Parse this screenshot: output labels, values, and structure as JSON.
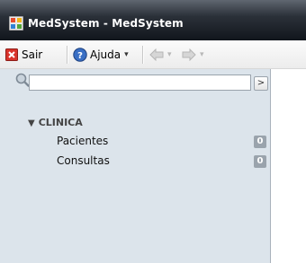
{
  "window": {
    "title": "MedSystem - MedSystem"
  },
  "toolbar": {
    "sair_label": "Sair",
    "ajuda_label": "Ajuda",
    "back_icon": "back-arrow-icon",
    "forward_icon": "forward-arrow-icon",
    "dropdown_glyph": "▾"
  },
  "search": {
    "value": "",
    "go_glyph": ">"
  },
  "nav": {
    "group": {
      "label": "CLINICA",
      "expanded_glyph": "▼"
    },
    "items": [
      {
        "label": "Pacientes",
        "count": "0"
      },
      {
        "label": "Consultas",
        "count": "0"
      }
    ]
  },
  "colors": {
    "titlebar": "#1c2229",
    "sidebar": "#dce4eb",
    "badge": "#9aa3ac"
  }
}
